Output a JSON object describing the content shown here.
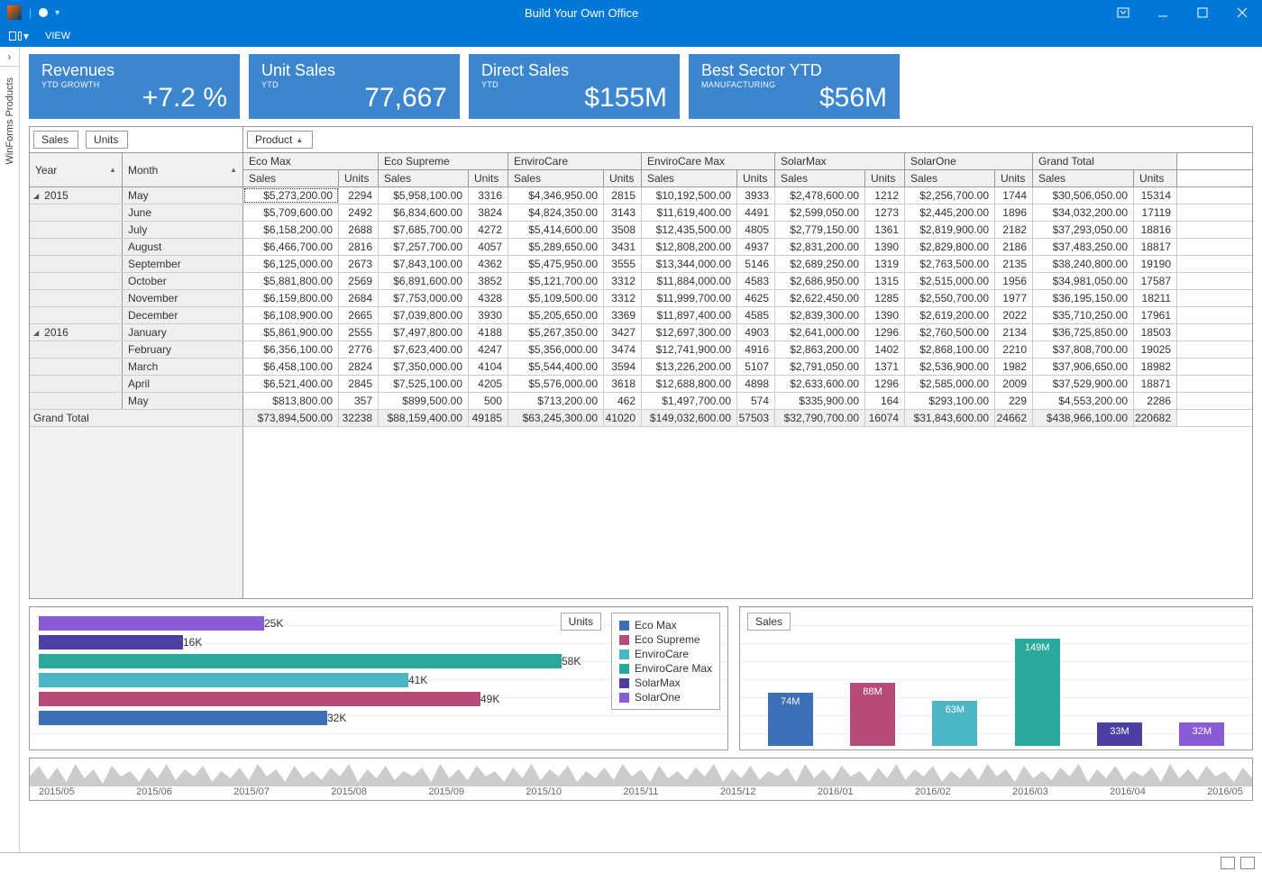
{
  "window": {
    "title": "Build Your Own Office"
  },
  "menu": {
    "view": "VIEW"
  },
  "sidebar": {
    "label": "WinForms Products"
  },
  "kpi": [
    {
      "title": "Revenues",
      "sub": "YTD GROWTH",
      "value": "+7.2 %"
    },
    {
      "title": "Unit Sales",
      "sub": "YTD",
      "value": "77,667"
    },
    {
      "title": "Direct Sales",
      "sub": "YTD",
      "value": "$155M"
    },
    {
      "title": "Best Sector YTD",
      "sub": "MANUFACTURING",
      "value": "$56M"
    }
  ],
  "pivot": {
    "data_fields": [
      "Sales",
      "Units"
    ],
    "col_field": "Product",
    "row_fields": [
      "Year",
      "Month"
    ],
    "products": [
      "Eco Max",
      "Eco Supreme",
      "EnviroCare",
      "EnviroCare Max",
      "SolarMax",
      "SolarOne"
    ],
    "grand_total_label": "Grand Total",
    "sub_headers": [
      "Sales",
      "Units"
    ],
    "rows": [
      {
        "year": "2015",
        "month": "May",
        "c": [
          "$5,273,200.00",
          "2294",
          "$5,958,100.00",
          "3316",
          "$4,346,950.00",
          "2815",
          "$10,192,500.00",
          "3933",
          "$2,478,600.00",
          "1212",
          "$2,256,700.00",
          "1744",
          "$30,506,050.00",
          "15314"
        ]
      },
      {
        "year": "",
        "month": "June",
        "c": [
          "$5,709,600.00",
          "2492",
          "$6,834,600.00",
          "3824",
          "$4,824,350.00",
          "3143",
          "$11,619,400.00",
          "4491",
          "$2,599,050.00",
          "1273",
          "$2,445,200.00",
          "1896",
          "$34,032,200.00",
          "17119"
        ]
      },
      {
        "year": "",
        "month": "July",
        "c": [
          "$6,158,200.00",
          "2688",
          "$7,685,700.00",
          "4272",
          "$5,414,600.00",
          "3508",
          "$12,435,500.00",
          "4805",
          "$2,779,150.00",
          "1361",
          "$2,819,900.00",
          "2182",
          "$37,293,050.00",
          "18816"
        ]
      },
      {
        "year": "",
        "month": "August",
        "c": [
          "$6,466,700.00",
          "2816",
          "$7,257,700.00",
          "4057",
          "$5,289,650.00",
          "3431",
          "$12,808,200.00",
          "4937",
          "$2,831,200.00",
          "1390",
          "$2,829,800.00",
          "2186",
          "$37,483,250.00",
          "18817"
        ]
      },
      {
        "year": "",
        "month": "September",
        "c": [
          "$6,125,000.00",
          "2673",
          "$7,843,100.00",
          "4362",
          "$5,475,950.00",
          "3555",
          "$13,344,000.00",
          "5146",
          "$2,689,250.00",
          "1319",
          "$2,763,500.00",
          "2135",
          "$38,240,800.00",
          "19190"
        ]
      },
      {
        "year": "",
        "month": "October",
        "c": [
          "$5,881,800.00",
          "2569",
          "$6,891,600.00",
          "3852",
          "$5,121,700.00",
          "3312",
          "$11,884,000.00",
          "4583",
          "$2,686,950.00",
          "1315",
          "$2,515,000.00",
          "1956",
          "$34,981,050.00",
          "17587"
        ]
      },
      {
        "year": "",
        "month": "November",
        "c": [
          "$6,159,800.00",
          "2684",
          "$7,753,000.00",
          "4328",
          "$5,109,500.00",
          "3312",
          "$11,999,700.00",
          "4625",
          "$2,622,450.00",
          "1285",
          "$2,550,700.00",
          "1977",
          "$36,195,150.00",
          "18211"
        ]
      },
      {
        "year": "",
        "month": "December",
        "c": [
          "$6,108,900.00",
          "2665",
          "$7,039,800.00",
          "3930",
          "$5,205,650.00",
          "3369",
          "$11,897,400.00",
          "4585",
          "$2,839,300.00",
          "1390",
          "$2,619,200.00",
          "2022",
          "$35,710,250.00",
          "17961"
        ]
      },
      {
        "year": "2016",
        "month": "January",
        "c": [
          "$5,861,900.00",
          "2555",
          "$7,497,800.00",
          "4188",
          "$5,267,350.00",
          "3427",
          "$12,697,300.00",
          "4903",
          "$2,641,000.00",
          "1296",
          "$2,760,500.00",
          "2134",
          "$36,725,850.00",
          "18503"
        ]
      },
      {
        "year": "",
        "month": "February",
        "c": [
          "$6,356,100.00",
          "2776",
          "$7,623,400.00",
          "4247",
          "$5,356,000.00",
          "3474",
          "$12,741,900.00",
          "4916",
          "$2,863,200.00",
          "1402",
          "$2,868,100.00",
          "2210",
          "$37,808,700.00",
          "19025"
        ]
      },
      {
        "year": "",
        "month": "March",
        "c": [
          "$6,458,100.00",
          "2824",
          "$7,350,000.00",
          "4104",
          "$5,544,400.00",
          "3594",
          "$13,226,200.00",
          "5107",
          "$2,791,050.00",
          "1371",
          "$2,536,900.00",
          "1982",
          "$37,906,650.00",
          "18982"
        ]
      },
      {
        "year": "",
        "month": "April",
        "c": [
          "$6,521,400.00",
          "2845",
          "$7,525,100.00",
          "4205",
          "$5,576,000.00",
          "3618",
          "$12,688,800.00",
          "4898",
          "$2,633,600.00",
          "1296",
          "$2,585,000.00",
          "2009",
          "$37,529,900.00",
          "18871"
        ]
      },
      {
        "year": "",
        "month": "May",
        "c": [
          "$813,800.00",
          "357",
          "$899,500.00",
          "500",
          "$713,200.00",
          "462",
          "$1,497,700.00",
          "574",
          "$335,900.00",
          "164",
          "$293,100.00",
          "229",
          "$4,553,200.00",
          "2286"
        ]
      }
    ],
    "grand_total": [
      "$73,894,500.00",
      "32238",
      "$88,159,400.00",
      "49185",
      "$63,245,300.00",
      "41020",
      "$149,032,600.00",
      "57503",
      "$32,790,700.00",
      "16074",
      "$31,843,600.00",
      "24662",
      "$438,966,100.00",
      "220682"
    ]
  },
  "colors": {
    "EcoMax": "#3b6fb6",
    "EcoSupreme": "#b84a7a",
    "EnviroCare": "#4cb7c4",
    "EnviroCareMax": "#2aa89b",
    "SolarMax": "#4b3fa3",
    "SolarOne": "#8a5bd6"
  },
  "chart_data": [
    {
      "type": "bar",
      "orientation": "horizontal",
      "title": "",
      "badge": "Units",
      "categories": [
        "SolarOne",
        "SolarMax",
        "EnviroCare Max",
        "EnviroCare",
        "Eco Supreme",
        "Eco Max"
      ],
      "values": [
        25000,
        16000,
        58000,
        41000,
        49000,
        32000
      ],
      "value_labels": [
        "25K",
        "16K",
        "58K",
        "41K",
        "49K",
        "32K"
      ],
      "legend": [
        "Eco Max",
        "Eco Supreme",
        "EnviroCare",
        "EnviroCare Max",
        "SolarMax",
        "SolarOne"
      ]
    },
    {
      "type": "bar",
      "orientation": "vertical",
      "title": "",
      "badge": "Sales",
      "categories": [
        "Eco Max",
        "Eco Supreme",
        "EnviroCare",
        "EnviroCare Max",
        "SolarMax",
        "SolarOne"
      ],
      "values": [
        74,
        88,
        63,
        149,
        33,
        32
      ],
      "value_labels": [
        "74M",
        "88M",
        "63M",
        "149M",
        "33M",
        "32M"
      ],
      "ylim": [
        0,
        150
      ]
    }
  ],
  "range": {
    "ticks": [
      "2015/05",
      "2015/06",
      "2015/07",
      "2015/08",
      "2015/09",
      "2015/10",
      "2015/11",
      "2015/12",
      "2016/01",
      "2016/02",
      "2016/03",
      "2016/04",
      "2016/05"
    ]
  }
}
